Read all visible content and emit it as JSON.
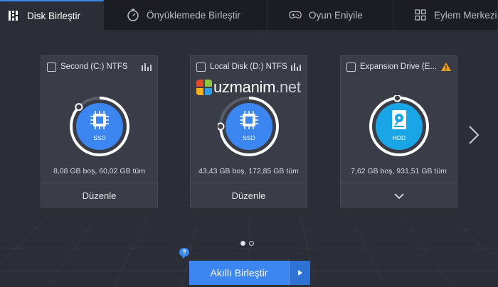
{
  "tabs": [
    {
      "label": "Disk Birleştir",
      "icon": "disk-defrag-icon",
      "active": true
    },
    {
      "label": "Önyüklemede Birleştir",
      "icon": "timer-icon",
      "active": false
    },
    {
      "label": "Oyun Eniyile",
      "icon": "gamepad-icon",
      "active": false
    },
    {
      "label": "Eylem Merkezi",
      "icon": "grid-icon",
      "active": false
    }
  ],
  "drives": [
    {
      "title": "Second (C:) NTFS",
      "type": "SSD",
      "free": "8,08 GB boş, 60,02 GB tüm",
      "footer": "Düzenle",
      "side_icon": "bar-chart-icon",
      "used_fraction": 0.87
    },
    {
      "title": "Local Disk (D:) NTFS",
      "type": "SSD",
      "free": "43,43 GB boş, 172,85 GB tüm",
      "footer": "Düzenle",
      "side_icon": "bar-chart-icon",
      "used_fraction": 0.75
    },
    {
      "title": "Expansion Drive (E...",
      "type": "HDD",
      "free": "7,62 GB boş, 931,51 GB tüm",
      "footer": "",
      "side_icon": "warning-icon",
      "used_fraction": 0.99
    }
  ],
  "watermark": {
    "brand": "uzmanim",
    "tld": ".net"
  },
  "help_badge": "?",
  "main_button": "Akıllı Birleştir",
  "colors": {
    "accent": "#3b86f0",
    "hdd": "#1aa5e6",
    "warning": "#f0a020",
    "background": "#2b2e37",
    "card": "#3a3d47"
  }
}
